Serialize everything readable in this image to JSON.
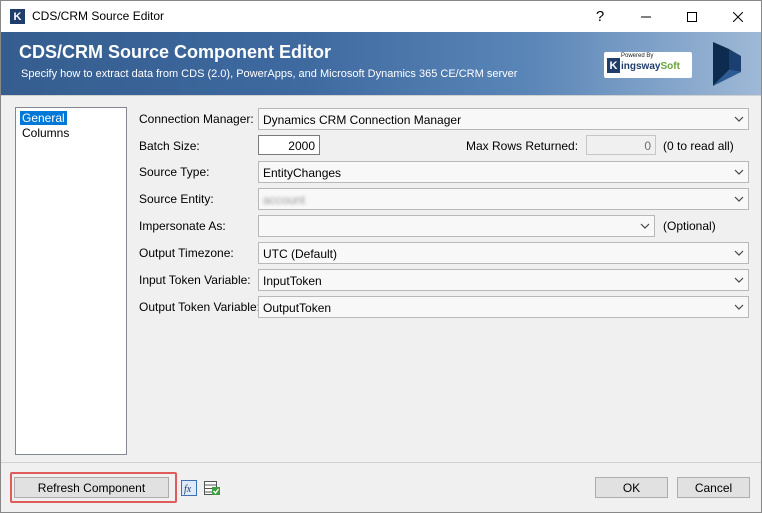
{
  "window": {
    "title": "CDS/CRM Source Editor",
    "icon_letter": "K"
  },
  "banner": {
    "title": "CDS/CRM Source Component Editor",
    "subtitle": "Specify how to extract data from CDS (2.0), PowerApps, and Microsoft Dynamics 365 CE/CRM server",
    "logo_powered": "Powered By",
    "logo_k": "K",
    "logo_name": "ingsway",
    "logo_soft": "Soft"
  },
  "nav": {
    "items": [
      {
        "label": "General",
        "selected": true
      },
      {
        "label": "Columns",
        "selected": false
      }
    ]
  },
  "form": {
    "connection_manager": {
      "label": "Connection Manager:",
      "value": "Dynamics CRM Connection Manager"
    },
    "batch_size": {
      "label": "Batch Size:",
      "value": "2000"
    },
    "max_rows": {
      "label": "Max Rows Returned:",
      "value": "0",
      "note": "(0 to read all)"
    },
    "source_type": {
      "label": "Source Type:",
      "value": "EntityChanges"
    },
    "source_entity": {
      "label": "Source Entity:",
      "value": "account"
    },
    "impersonate_as": {
      "label": "Impersonate As:",
      "value": "",
      "note": "(Optional)"
    },
    "output_timezone": {
      "label": "Output Timezone:",
      "value": "UTC (Default)"
    },
    "input_token": {
      "label": "Input Token Variable:",
      "value": "InputToken"
    },
    "output_token": {
      "label": "Output Token Variable:",
      "value": "OutputToken"
    }
  },
  "buttons": {
    "refresh": "Refresh Component",
    "ok": "OK",
    "cancel": "Cancel"
  },
  "icons": {
    "fx": "fx"
  },
  "colors": {
    "selection": "#0078d7",
    "highlight": "#e05b5b",
    "banner": "#355d8f"
  }
}
